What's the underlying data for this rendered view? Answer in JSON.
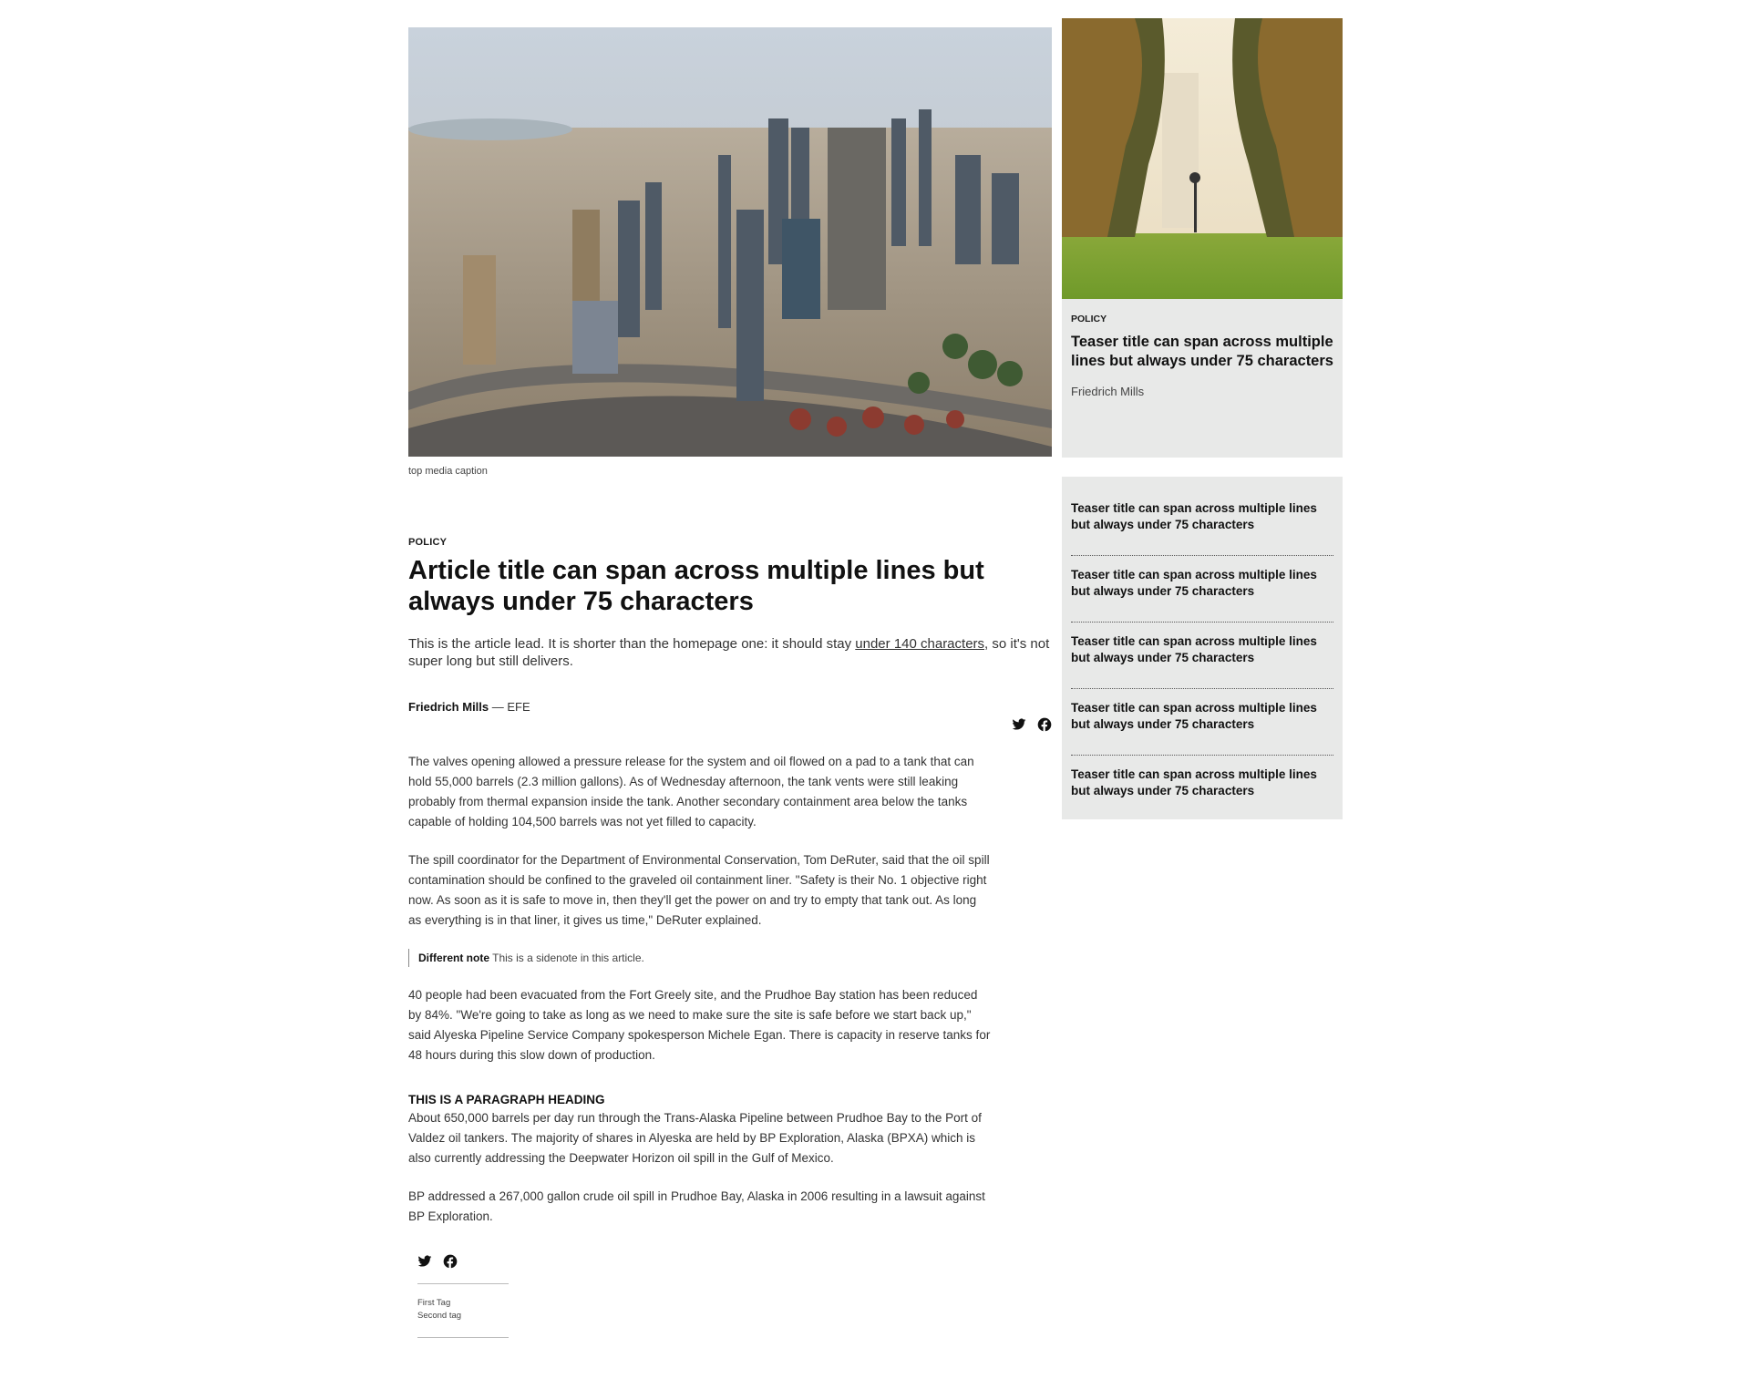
{
  "hero": {
    "caption": "top media caption"
  },
  "article": {
    "category": "POLICY",
    "title": "Article title can span across multiple lines but always under 75 characters",
    "lead_before": "This is the article lead. It is shorter than the homepage one: it should stay ",
    "lead_link": "under 140 characters",
    "lead_after": ", so it's not super long but still delivers.",
    "author": "Friedrich Mills",
    "byline_sep": " — ",
    "source": "EFE",
    "paragraphs": [
      "The valves opening allowed a pressure release for the system and oil flowed on a pad to a tank that can hold 55,000 barrels (2.3 million gallons). As of Wednesday afternoon, the tank vents were still leaking probably from thermal expansion inside the tank. Another secondary containment area below the tanks capable of holding 104,500 barrels was not yet filled to capacity.",
      "The spill coordinator for the Department of Environmental Conservation, Tom DeRuter, said that the oil spill contamination should be confined to the graveled oil containment liner. \"Safety is their No. 1 objective right now. As soon as it is safe to move in, then they'll get the power on and try to empty that tank out. As long as everything is in that liner, it gives us time,\" DeRuter explained.",
      "40 people had been evacuated from the Fort Greely site, and the Prudhoe Bay station has been reduced by 84%. \"We're going to take as long as we need to make sure the site is safe before we start back up,\" said Alyeska Pipeline Service Company spokesperson Michele Egan. There is capacity in reserve tanks for 48 hours during this slow down of production.",
      "About 650,000 barrels per day run through the Trans-Alaska Pipeline between Prudhoe Bay to the Port of Valdez oil tankers. The majority of shares in Alyeska are held by BP Exploration, Alaska (BPXA) which is also currently addressing the Deepwater Horizon oil spill in the Gulf of Mexico.",
      "BP addressed a 267,000 gallon crude oil spill in Prudhoe Bay, Alaska in 2006 resulting in a lawsuit against BP Exploration."
    ],
    "sidenote_label": "Different note",
    "sidenote_text": " This is a sidenote in this article.",
    "paragraph_heading": "THIS IS A PARAGRAPH HEADING",
    "tags": [
      "First Tag",
      "Second tag"
    ]
  },
  "share": {
    "twitter_icon": "twitter-icon",
    "facebook_icon": "facebook-icon"
  },
  "sidebar": {
    "featured": {
      "category": "POLICY",
      "title": "Teaser title can span across multiple lines but always under 75 characters",
      "author": "Friedrich Mills"
    },
    "teasers": [
      "Teaser title can span across multiple lines but always under 75 characters",
      "Teaser title can span across multiple lines but always under 75 characters",
      "Teaser title can span across multiple lines but always under 75 characters",
      "Teaser title can span across multiple lines but always under 75 characters",
      "Teaser title can span across multiple lines but always under 75 characters"
    ]
  }
}
